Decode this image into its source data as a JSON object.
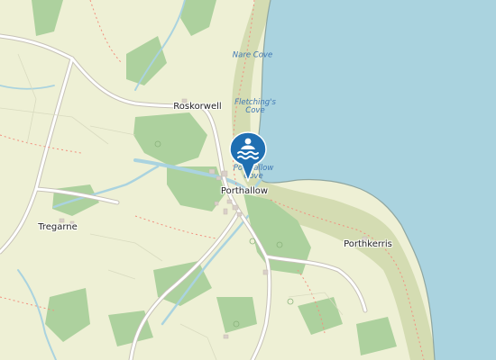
{
  "map": {
    "places": [
      {
        "id": "roskorwell",
        "name": "Roskorwell"
      },
      {
        "id": "porthallow",
        "name": "Porthallow"
      },
      {
        "id": "tregarne",
        "name": "Tregarne"
      },
      {
        "id": "porthkerris",
        "name": "Porthkerris"
      }
    ],
    "water_labels": [
      {
        "id": "nare",
        "line1": "Nare Cove",
        "line2": ""
      },
      {
        "id": "fletchings",
        "line1": "Fletching's",
        "line2": "Cove"
      },
      {
        "id": "porthallow-cove",
        "line1": "Porthallow",
        "line2": "Cove"
      }
    ],
    "marker": {
      "icon": "swimming-icon",
      "color": "#1f6fb2"
    },
    "colors": {
      "sea": "#aad3df",
      "land": "#f2efe9",
      "farmland": "#eef0d5",
      "wood": "#add19e",
      "scrub": "#c8d7ab",
      "river": "#aad3df"
    }
  }
}
